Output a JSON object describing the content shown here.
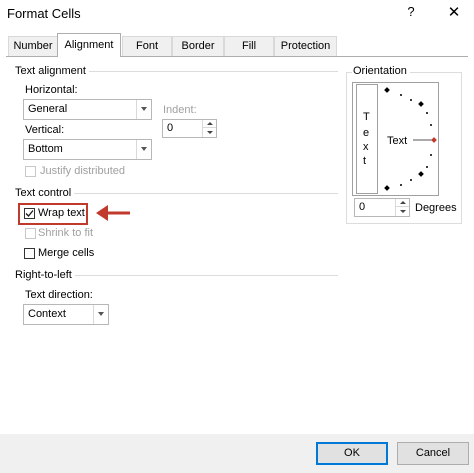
{
  "window": {
    "title": "Format Cells",
    "help": "?",
    "close": "✕"
  },
  "tabs": [
    "Number",
    "Alignment",
    "Font",
    "Border",
    "Fill",
    "Protection"
  ],
  "text_alignment": {
    "heading": "Text alignment",
    "horizontal_label": "Horizontal:",
    "horizontal_value": "General",
    "vertical_label": "Vertical:",
    "vertical_value": "Bottom",
    "indent_label": "Indent:",
    "indent_value": "0",
    "justify_distributed": "Justify distributed"
  },
  "text_control": {
    "heading": "Text control",
    "wrap_text": "Wrap text",
    "shrink_to_fit": "Shrink to fit",
    "merge_cells": "Merge cells",
    "wrap_checked": true,
    "highlight_color": "#c0392b"
  },
  "right_to_left": {
    "heading": "Right-to-left",
    "direction_label": "Text direction:",
    "direction_value": "Context"
  },
  "orientation": {
    "heading": "Orientation",
    "vertical_text": [
      "T",
      "e",
      "x",
      "t"
    ],
    "text_label": "Text",
    "degrees_value": "0",
    "degrees_label": "Degrees",
    "needle_color": "#c0392b"
  },
  "footer": {
    "ok": "OK",
    "cancel": "Cancel"
  }
}
